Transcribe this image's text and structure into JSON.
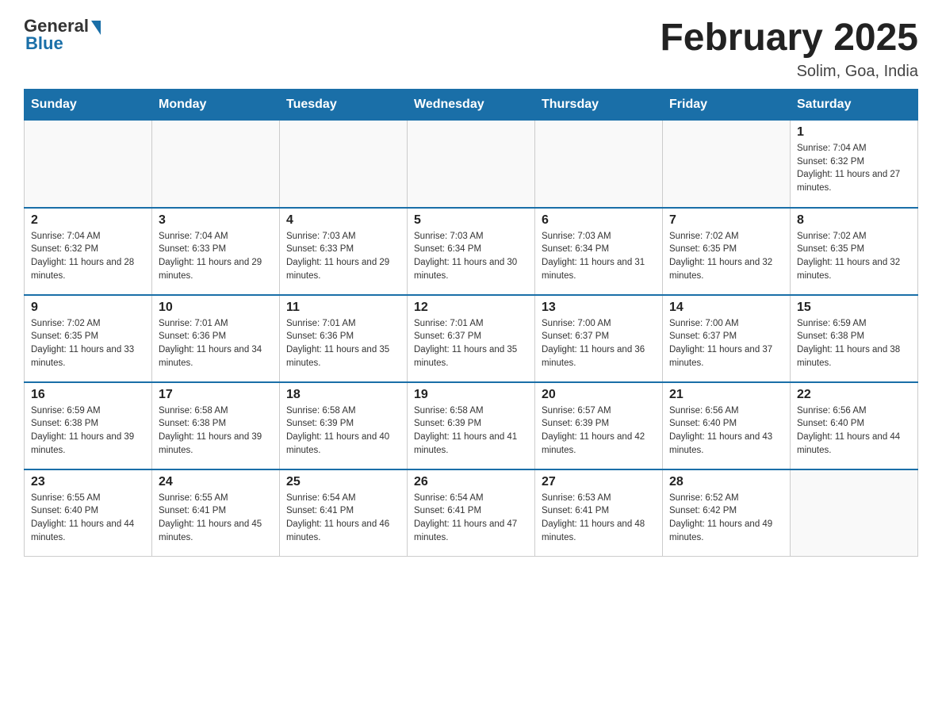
{
  "logo": {
    "general": "General",
    "blue": "Blue"
  },
  "header": {
    "title": "February 2025",
    "location": "Solim, Goa, India"
  },
  "weekdays": [
    "Sunday",
    "Monday",
    "Tuesday",
    "Wednesday",
    "Thursday",
    "Friday",
    "Saturday"
  ],
  "weeks": [
    [
      null,
      null,
      null,
      null,
      null,
      null,
      {
        "day": "1",
        "sunrise": "Sunrise: 7:04 AM",
        "sunset": "Sunset: 6:32 PM",
        "daylight": "Daylight: 11 hours and 27 minutes."
      }
    ],
    [
      {
        "day": "2",
        "sunrise": "Sunrise: 7:04 AM",
        "sunset": "Sunset: 6:32 PM",
        "daylight": "Daylight: 11 hours and 28 minutes."
      },
      {
        "day": "3",
        "sunrise": "Sunrise: 7:04 AM",
        "sunset": "Sunset: 6:33 PM",
        "daylight": "Daylight: 11 hours and 29 minutes."
      },
      {
        "day": "4",
        "sunrise": "Sunrise: 7:03 AM",
        "sunset": "Sunset: 6:33 PM",
        "daylight": "Daylight: 11 hours and 29 minutes."
      },
      {
        "day": "5",
        "sunrise": "Sunrise: 7:03 AM",
        "sunset": "Sunset: 6:34 PM",
        "daylight": "Daylight: 11 hours and 30 minutes."
      },
      {
        "day": "6",
        "sunrise": "Sunrise: 7:03 AM",
        "sunset": "Sunset: 6:34 PM",
        "daylight": "Daylight: 11 hours and 31 minutes."
      },
      {
        "day": "7",
        "sunrise": "Sunrise: 7:02 AM",
        "sunset": "Sunset: 6:35 PM",
        "daylight": "Daylight: 11 hours and 32 minutes."
      },
      {
        "day": "8",
        "sunrise": "Sunrise: 7:02 AM",
        "sunset": "Sunset: 6:35 PM",
        "daylight": "Daylight: 11 hours and 32 minutes."
      }
    ],
    [
      {
        "day": "9",
        "sunrise": "Sunrise: 7:02 AM",
        "sunset": "Sunset: 6:35 PM",
        "daylight": "Daylight: 11 hours and 33 minutes."
      },
      {
        "day": "10",
        "sunrise": "Sunrise: 7:01 AM",
        "sunset": "Sunset: 6:36 PM",
        "daylight": "Daylight: 11 hours and 34 minutes."
      },
      {
        "day": "11",
        "sunrise": "Sunrise: 7:01 AM",
        "sunset": "Sunset: 6:36 PM",
        "daylight": "Daylight: 11 hours and 35 minutes."
      },
      {
        "day": "12",
        "sunrise": "Sunrise: 7:01 AM",
        "sunset": "Sunset: 6:37 PM",
        "daylight": "Daylight: 11 hours and 35 minutes."
      },
      {
        "day": "13",
        "sunrise": "Sunrise: 7:00 AM",
        "sunset": "Sunset: 6:37 PM",
        "daylight": "Daylight: 11 hours and 36 minutes."
      },
      {
        "day": "14",
        "sunrise": "Sunrise: 7:00 AM",
        "sunset": "Sunset: 6:37 PM",
        "daylight": "Daylight: 11 hours and 37 minutes."
      },
      {
        "day": "15",
        "sunrise": "Sunrise: 6:59 AM",
        "sunset": "Sunset: 6:38 PM",
        "daylight": "Daylight: 11 hours and 38 minutes."
      }
    ],
    [
      {
        "day": "16",
        "sunrise": "Sunrise: 6:59 AM",
        "sunset": "Sunset: 6:38 PM",
        "daylight": "Daylight: 11 hours and 39 minutes."
      },
      {
        "day": "17",
        "sunrise": "Sunrise: 6:58 AM",
        "sunset": "Sunset: 6:38 PM",
        "daylight": "Daylight: 11 hours and 39 minutes."
      },
      {
        "day": "18",
        "sunrise": "Sunrise: 6:58 AM",
        "sunset": "Sunset: 6:39 PM",
        "daylight": "Daylight: 11 hours and 40 minutes."
      },
      {
        "day": "19",
        "sunrise": "Sunrise: 6:58 AM",
        "sunset": "Sunset: 6:39 PM",
        "daylight": "Daylight: 11 hours and 41 minutes."
      },
      {
        "day": "20",
        "sunrise": "Sunrise: 6:57 AM",
        "sunset": "Sunset: 6:39 PM",
        "daylight": "Daylight: 11 hours and 42 minutes."
      },
      {
        "day": "21",
        "sunrise": "Sunrise: 6:56 AM",
        "sunset": "Sunset: 6:40 PM",
        "daylight": "Daylight: 11 hours and 43 minutes."
      },
      {
        "day": "22",
        "sunrise": "Sunrise: 6:56 AM",
        "sunset": "Sunset: 6:40 PM",
        "daylight": "Daylight: 11 hours and 44 minutes."
      }
    ],
    [
      {
        "day": "23",
        "sunrise": "Sunrise: 6:55 AM",
        "sunset": "Sunset: 6:40 PM",
        "daylight": "Daylight: 11 hours and 44 minutes."
      },
      {
        "day": "24",
        "sunrise": "Sunrise: 6:55 AM",
        "sunset": "Sunset: 6:41 PM",
        "daylight": "Daylight: 11 hours and 45 minutes."
      },
      {
        "day": "25",
        "sunrise": "Sunrise: 6:54 AM",
        "sunset": "Sunset: 6:41 PM",
        "daylight": "Daylight: 11 hours and 46 minutes."
      },
      {
        "day": "26",
        "sunrise": "Sunrise: 6:54 AM",
        "sunset": "Sunset: 6:41 PM",
        "daylight": "Daylight: 11 hours and 47 minutes."
      },
      {
        "day": "27",
        "sunrise": "Sunrise: 6:53 AM",
        "sunset": "Sunset: 6:41 PM",
        "daylight": "Daylight: 11 hours and 48 minutes."
      },
      {
        "day": "28",
        "sunrise": "Sunrise: 6:52 AM",
        "sunset": "Sunset: 6:42 PM",
        "daylight": "Daylight: 11 hours and 49 minutes."
      },
      null
    ]
  ]
}
